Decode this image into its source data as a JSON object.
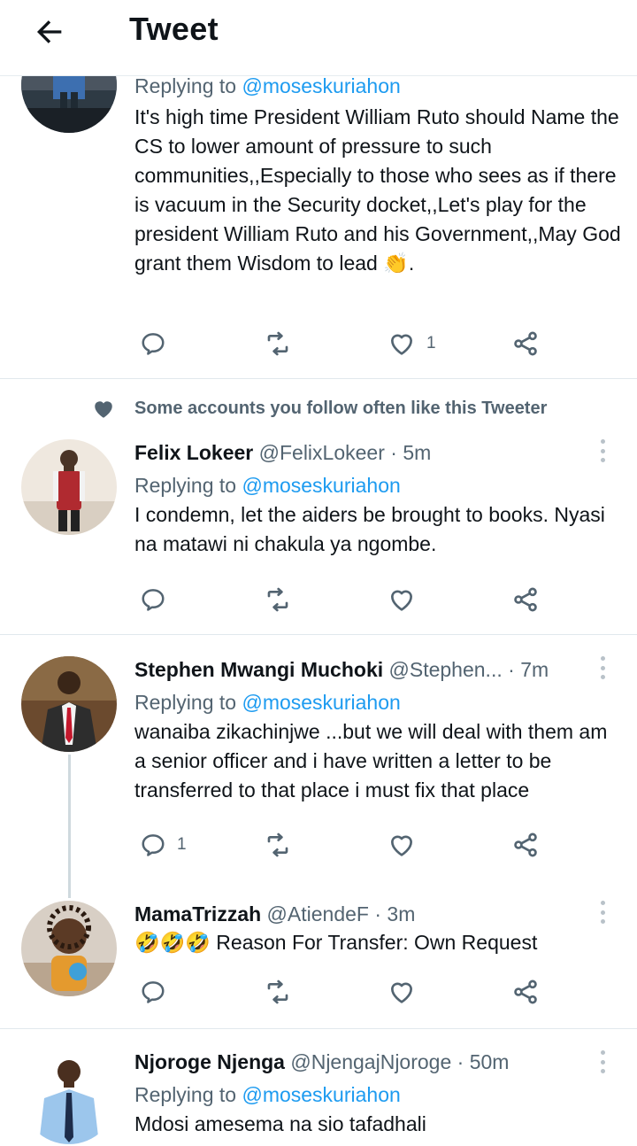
{
  "topbar": {
    "title": "Tweet"
  },
  "tweets": [
    {
      "reply_prefix": "Replying to",
      "reply_mention": "@moseskuriahon",
      "text": "It's high time President William Ruto should Name the CS to lower amount of pressure to such communities,,Especially to those who sees as if there is vacuum in the Security docket,,Let's play for the president William Ruto and his Government,,May God grant them Wisdom to lead 👏.",
      "reply_count": "",
      "like_count": "1"
    },
    {
      "social_context": "Some accounts you follow often like this Tweeter",
      "name": "Felix Lokeer",
      "handle": "@FelixLokeer",
      "separator": "·",
      "time": "5m",
      "reply_prefix": "Replying to",
      "reply_mention": "@moseskuriahon",
      "text": "I condemn, let the aiders be brought to books. Nyasi na matawi ni chakula ya ngombe.",
      "reply_count": "",
      "like_count": ""
    },
    {
      "name": "Stephen Mwangi Muchoki",
      "handle": "@Stephen...",
      "separator": "·",
      "time": "7m",
      "reply_prefix": "Replying to",
      "reply_mention": "@moseskuriahon",
      "text": "wanaiba zikachinjwe ...but we will deal with them am a senior officer and i have written a letter to be transferred to that place i must fix that place",
      "reply_count": "1",
      "like_count": ""
    },
    {
      "name": "MamaTrizzah",
      "handle": "@AtiendeF",
      "separator": "·",
      "time": "3m",
      "text": "🤣🤣🤣 Reason For Transfer:  Own Request",
      "reply_count": "",
      "like_count": ""
    },
    {
      "name": "Njoroge Njenga",
      "handle": "@NjengajNjoroge",
      "separator": "·",
      "time": "50m",
      "reply_prefix": "Replying to",
      "reply_mention": "@moseskuriahon",
      "text": "Mdosi amesema na sio tafadhali"
    }
  ],
  "icons": {
    "back": "arrow-left-icon",
    "reply": "reply-icon",
    "retweet": "retweet-icon",
    "like": "heart-icon",
    "share": "share-icon",
    "more": "more-vertical-icon",
    "social": "heart-filled-icon"
  },
  "colors": {
    "accent": "#1d9bf0",
    "muted": "#536471",
    "text": "#0f1419",
    "divider": "#e1e8ed"
  }
}
